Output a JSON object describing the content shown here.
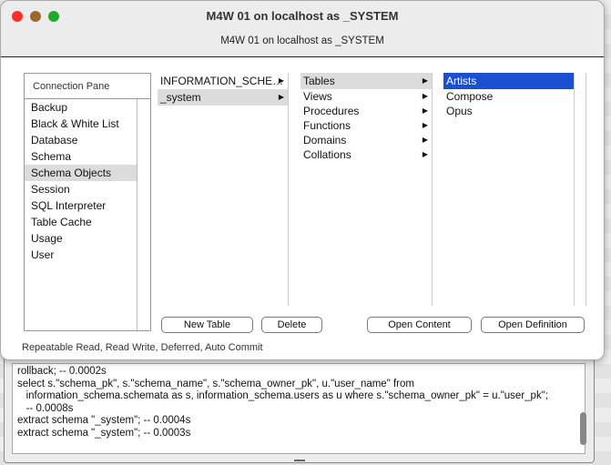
{
  "window": {
    "title": "M4W 01 on localhost as _SYSTEM",
    "subtitle": "M4W 01 on localhost as _SYSTEM"
  },
  "connection_pane": {
    "tab": "Connection Pane",
    "items": [
      "Backup",
      "Black & White List",
      "Database",
      "Schema",
      "Schema Objects",
      "Session",
      "SQL Interpreter",
      "Table Cache",
      "Usage",
      "User"
    ],
    "selected": "Schema Objects"
  },
  "schemas": [
    "INFORMATION_SCHE…",
    "_system"
  ],
  "object_types": [
    "Tables",
    "Views",
    "Procedures",
    "Functions",
    "Domains",
    "Collations"
  ],
  "tables": [
    "Artists",
    "Compose",
    "Opus"
  ],
  "buttons": {
    "new_table": "New Table",
    "delete": "Delete",
    "open_content": "Open Content",
    "open_definition": "Open Definition"
  },
  "status": "Repeatable Read, Read Write, Deferred, Auto Commit",
  "log": [
    "rollback; -- 0.0002s",
    "select s.\"schema_pk\", s.\"schema_name\", s.\"schema_owner_pk\", u.\"user_name\" from",
    "   information_schema.schemata as s, information_schema.users as u where s.\"schema_owner_pk\" = u.\"user_pk\";",
    "   -- 0.0008s",
    "extract schema \"_system\"; -- 0.0004s",
    "extract schema \"_system\"; -- 0.0003s"
  ]
}
